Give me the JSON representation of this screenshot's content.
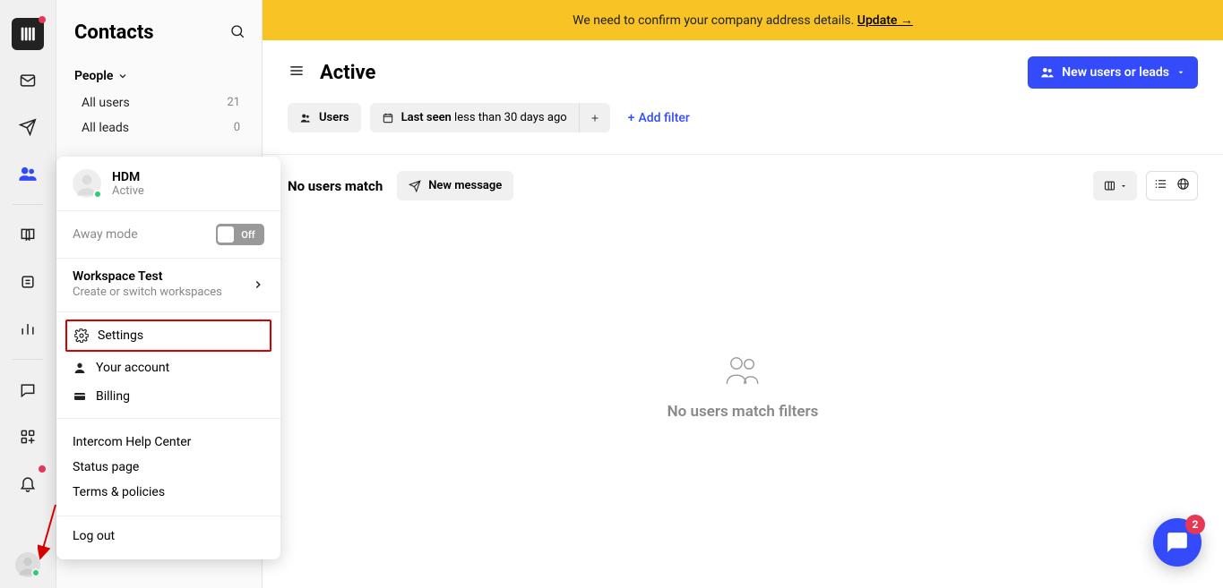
{
  "banner": {
    "text": "We need to confirm your company address details. ",
    "link": "Update →"
  },
  "sidepanel": {
    "title": "Contacts",
    "people_label": "People",
    "items": [
      {
        "label": "All users",
        "count": "21"
      },
      {
        "label": "All leads",
        "count": "0"
      }
    ]
  },
  "popover": {
    "name": "HDM",
    "status": "Active",
    "away_label": "Away mode",
    "toggle_state": "Off",
    "workspace": "Workspace Test",
    "workspace_sub": "Create or switch workspaces",
    "settings": "Settings",
    "account": "Your account",
    "billing": "Billing",
    "help_center": "Intercom Help Center",
    "status_page": "Status page",
    "terms": "Terms & policies",
    "logout": "Log out"
  },
  "main": {
    "title": "Active",
    "new_users_btn": "New users or leads",
    "pill_users": "Users",
    "pill_lastseen_label": "Last seen",
    "pill_lastseen_value": " less than 30 days ago",
    "add_filter": "Add filter",
    "no_match": "No users match",
    "new_message": "New message",
    "empty_text": "No users match filters"
  },
  "chat_badge": "2"
}
